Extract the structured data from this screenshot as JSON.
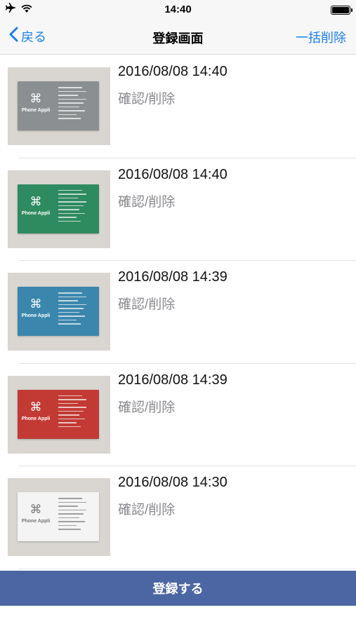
{
  "status_bar": {
    "time": "14:40",
    "airplane_icon": "airplane-icon",
    "wifi_icon": "wifi-icon",
    "battery_icon": "battery-icon"
  },
  "nav": {
    "back_label": "戻る",
    "title": "登録画面",
    "delete_all_label": "一括削除"
  },
  "list": {
    "items": [
      {
        "date": "2016/08/08 14:40",
        "action": "確認/削除",
        "card_color": "#8c8f91",
        "card_brand": "Phone Appli",
        "card_logo": "⌘"
      },
      {
        "date": "2016/08/08 14:40",
        "action": "確認/削除",
        "card_color": "#2e8a5f",
        "card_brand": "Phone Appli",
        "card_logo": "⌘"
      },
      {
        "date": "2016/08/08 14:39",
        "action": "確認/削除",
        "card_color": "#3b86ad",
        "card_brand": "Phone Appli",
        "card_logo": "⌘"
      },
      {
        "date": "2016/08/08 14:39",
        "action": "確認/削除",
        "card_color": "#c23a33",
        "card_brand": "Phone Appli",
        "card_logo": "⌘"
      },
      {
        "date": "2016/08/08 14:30",
        "action": "確認/削除",
        "card_color": "#f4f4f4",
        "card_brand": "Phone Appli",
        "card_logo": "⌘"
      }
    ]
  },
  "footer": {
    "register_label": "登録する",
    "register_color": "#4b66a3"
  },
  "colors": {
    "accent": "#1a7ef0",
    "secondary_text": "#8a8a8f"
  }
}
